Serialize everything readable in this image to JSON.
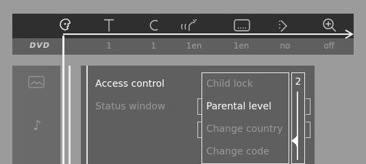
{
  "colors": {
    "background": "#9b9b9b",
    "top_bar": "#2f2f2f",
    "value_bar": "#5f5f5f",
    "panel": "#5f5f5f",
    "text_active": "#ffffff",
    "text_dim": "#9a9a9a"
  },
  "top_menu": {
    "logo": "DVD",
    "icons": [
      "user-icon",
      "title-icon",
      "chapter-icon",
      "audio-icon",
      "subtitle-icon",
      "angle-icon",
      "zoom-icon"
    ],
    "values": [
      "1",
      "1",
      "1en",
      "1en",
      "no",
      "off"
    ]
  },
  "side_menu": {
    "icons": [
      "picture-icon",
      "music-note-icon"
    ]
  },
  "main_menu": {
    "items": [
      "Access control",
      "Status window"
    ],
    "selected": "Access control"
  },
  "submenu": {
    "items": [
      "Child lock",
      "Parental level",
      "Change country",
      "Change code"
    ],
    "highlighted": "Parental level"
  },
  "level_scroller": {
    "value": "2"
  }
}
